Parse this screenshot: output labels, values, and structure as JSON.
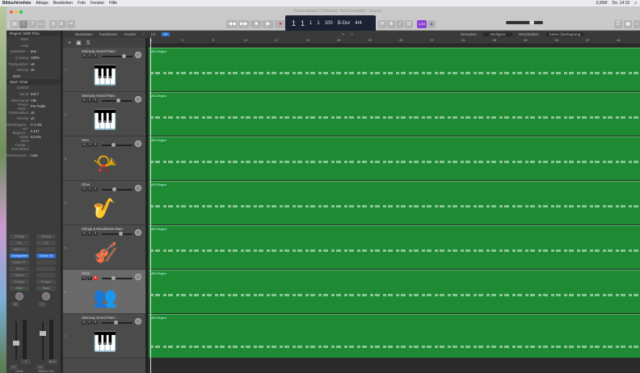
{
  "menubar": {
    "app": "Bildschirmfoto",
    "items": [
      "Ablage",
      "Bearbeiten",
      "Foto",
      "Fenster",
      "Hilfe"
    ],
    "status": "0,00M",
    "clock": "Do. 14:16"
  },
  "window": {
    "title": "Personal​band (Vollständ. Text Kompakt) - Spuren"
  },
  "lcd": {
    "bar": "1",
    "beat": "1",
    "div": "1",
    "tick": "1",
    "tempo": "100",
    "key": "B-Dur",
    "sig": "4/4"
  },
  "control": {
    "count_in": "1234"
  },
  "localbar": {
    "menus": [
      "Bearbeiten",
      "Funktionen",
      "Ansicht"
    ],
    "snap_label": "Einrasten:",
    "snap_value": "Intelligent",
    "drag_label": "Verschieben:",
    "drag_value": "Keine Überlappung"
  },
  "inspector": {
    "region_header": "Region: MIDI Thru",
    "region_rows": [
      {
        "k": "Mute:",
        "v": ""
      },
      {
        "k": "Loop:",
        "v": ""
      },
      {
        "k": "Quantisier...:",
        "v": "aus"
      },
      {
        "k": "Q-Swing:",
        "v": "100%"
      },
      {
        "k": "Transposition:",
        "v": "±0"
      },
      {
        "k": "Velocity:",
        "v": "±0"
      }
    ],
    "more": "Mehr",
    "track_header": "Spur: Choir",
    "track_rows": [
      {
        "k": "Symbol:",
        "v": ""
      },
      {
        "k": "Kanal:",
        "v": "Inst 7"
      },
      {
        "k": "MIDI-Kanal:",
        "v": "Alle"
      },
      {
        "k": "Freeze-Modi...:",
        "v": "Pre Fader"
      },
      {
        "k": "Transposition:",
        "v": "±0"
      },
      {
        "k": "Velocity:",
        "v": "±0"
      },
      {
        "k": "Notenbegren...:",
        "v": "C-2   G8"
      },
      {
        "k": "Vel.-Begrenz...:",
        "v": "0   127"
      },
      {
        "k": "Delay:",
        "v": "0,0 ms"
      },
      {
        "k": "Ohne Transp...:",
        "v": ""
      },
      {
        "k": "Kein Reset:",
        "v": ""
      },
      {
        "k": "Notensystem...:",
        "v": "Auto"
      }
    ],
    "strips": [
      {
        "buttons": [
          "Setting",
          "EQ",
          "MIDI FX",
          "Omnisphere",
          "Audio FX",
          "Send",
          "Stereo",
          "Gruppe",
          "Read"
        ],
        "pan": "58",
        "name": "Choir",
        "ms": [
          "M",
          "S"
        ]
      },
      {
        "buttons": [
          "Setting",
          "EQ",
          "",
          "Ozone Oz",
          "",
          "",
          "",
          "Gruppe",
          "Read"
        ],
        "pan": "0",
        "name": "Stereo Out",
        "ms": [
          "M",
          "Bnce"
        ]
      }
    ]
  },
  "tracks": [
    {
      "num": "1",
      "name": "Steinway Grand Piano",
      "icon": "🎹",
      "vol": 0.75,
      "rec": false,
      "sel": false
    },
    {
      "num": "2",
      "name": "Steinway Grand Piano",
      "icon": "🎹",
      "vol": 0.55,
      "rec": false,
      "sel": false
    },
    {
      "num": "3",
      "name": "Horn",
      "icon": "📯",
      "vol": 0.35,
      "rec": false,
      "sel": false
    },
    {
      "num": "4",
      "name": "Oboe",
      "icon": "🎷",
      "vol": 0.4,
      "rec": false,
      "sel": false
    },
    {
      "num": "5",
      "name": "Strings & Woodwinds Stacc",
      "icon": "🎻",
      "vol": 0.65,
      "rec": false,
      "sel": false
    },
    {
      "num": "6",
      "name": "Choir",
      "icon": "👥",
      "vol": 0.35,
      "rec": true,
      "sel": true
    },
    {
      "num": "7",
      "name": "Steinway Grand Piano",
      "icon": "🎹",
      "vol": 0.45,
      "rec": false,
      "sel": false
    }
  ],
  "region_label": "MIDI-Region",
  "ruler": [
    "1",
    "5",
    "9",
    "13",
    "17",
    "21",
    "25",
    "29",
    "33",
    "37",
    "41",
    "45",
    "49",
    "53",
    "57",
    "61"
  ],
  "colors": {
    "region": "#1e8a34",
    "rec": "#dd3333",
    "accent": "#2f6fd0"
  }
}
